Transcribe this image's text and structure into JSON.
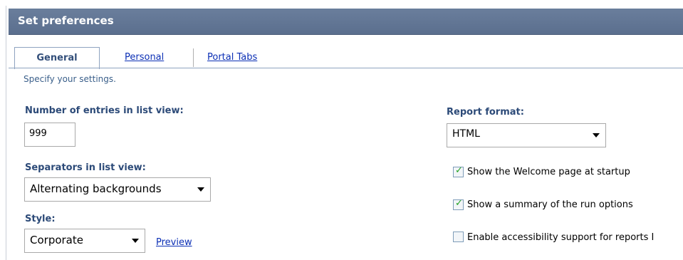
{
  "header": {
    "title": "Set preferences"
  },
  "tabs": [
    {
      "label": "General"
    },
    {
      "label": "Personal"
    },
    {
      "label": "Portal Tabs"
    }
  ],
  "instruction": "Specify your settings.",
  "entries": {
    "label": "Number of entries in list view:",
    "value": "999"
  },
  "separators": {
    "label": "Separators in list view:",
    "value": "Alternating backgrounds"
  },
  "style": {
    "label": "Style:",
    "value": "Corporate",
    "preview_link": "Preview"
  },
  "report": {
    "label": "Report format:",
    "value": "HTML"
  },
  "options": [
    {
      "label": "Show the Welcome page at startup",
      "checked": true
    },
    {
      "label": "Show a summary of the run options",
      "checked": true
    },
    {
      "label": "Enable accessibility support for reports I",
      "checked": false
    }
  ]
}
